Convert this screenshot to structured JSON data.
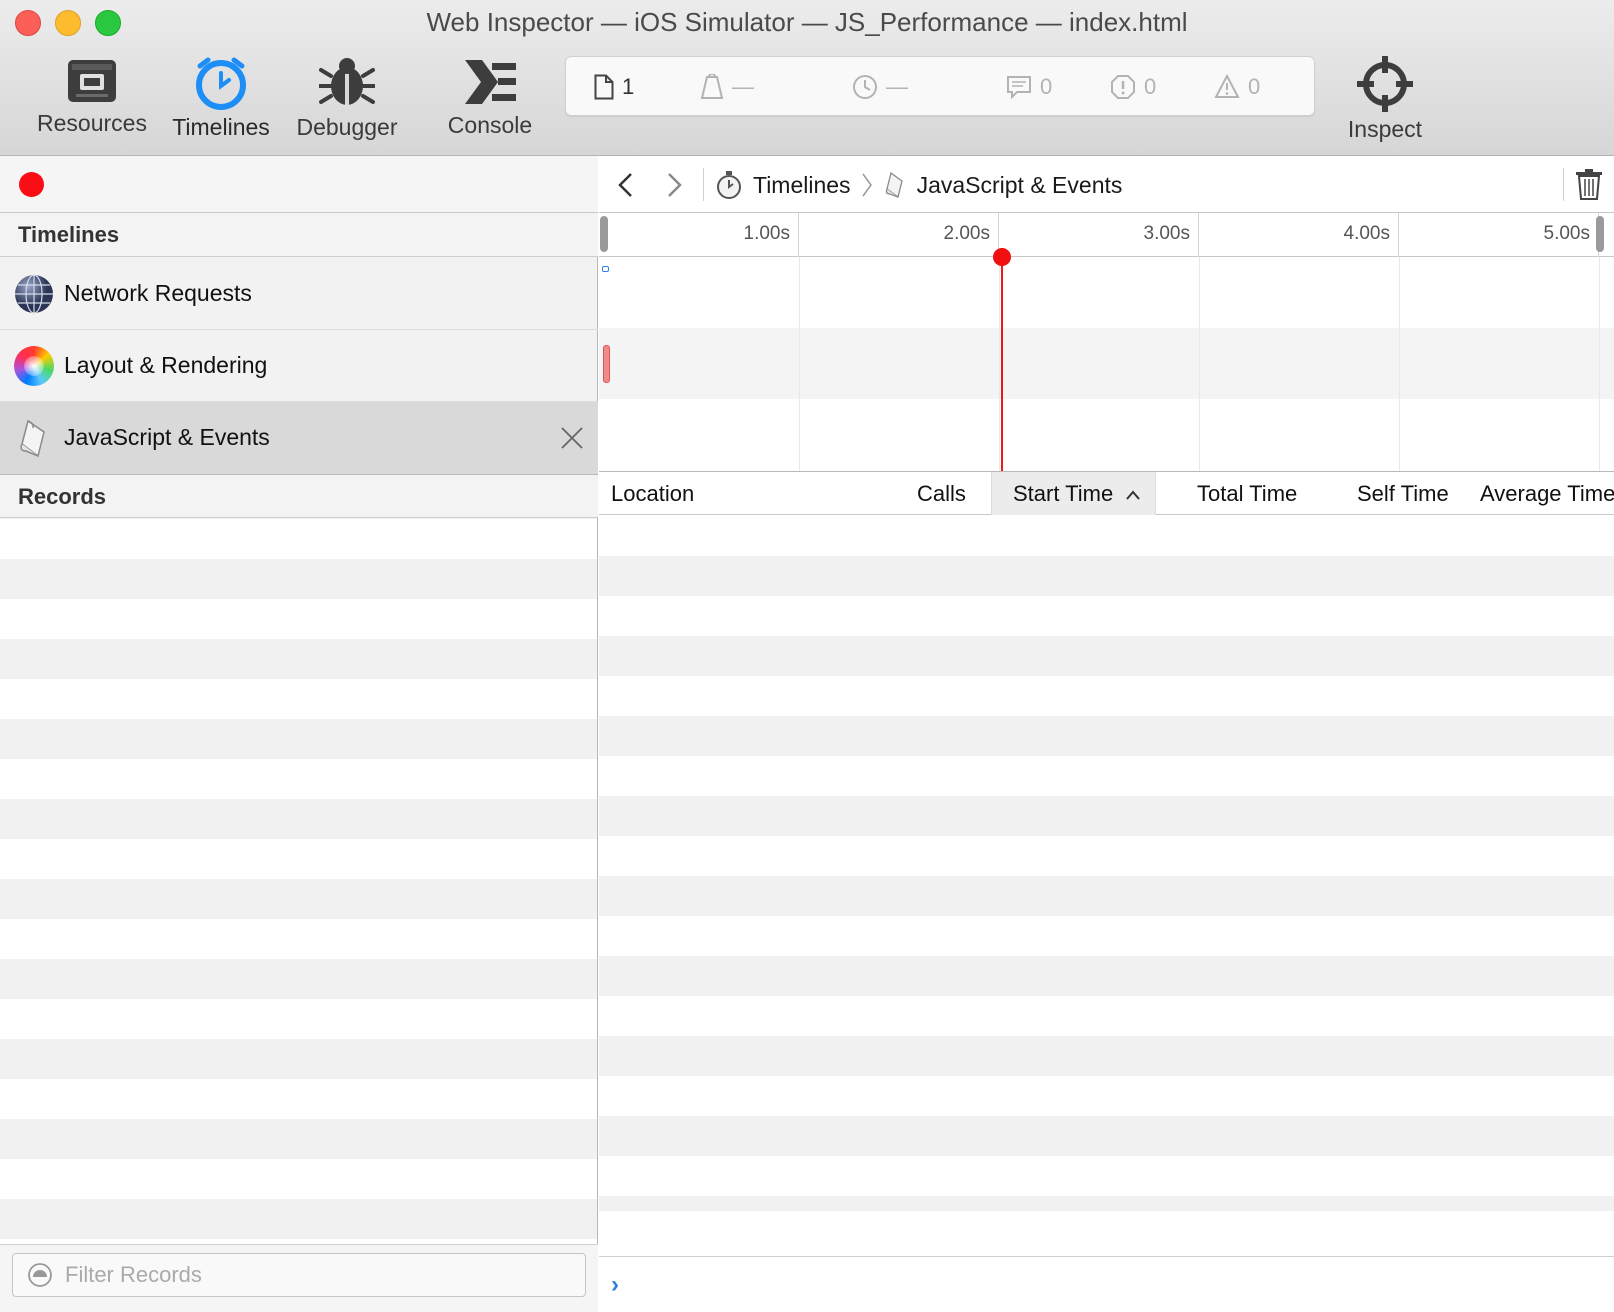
{
  "window": {
    "title": "Web Inspector — iOS Simulator — JS_Performance — index.html"
  },
  "toolbar": {
    "tabs": [
      {
        "label": "Resources",
        "icon": "resources-icon"
      },
      {
        "label": "Timelines",
        "icon": "timelines-icon",
        "active": true
      },
      {
        "label": "Debugger",
        "icon": "debugger-icon"
      },
      {
        "label": "Console",
        "icon": "console-icon"
      }
    ],
    "inspect_label": "Inspect"
  },
  "dashboard": {
    "resources_count": "1",
    "resources_size": "—",
    "load_time": "—",
    "logs": "0",
    "errors": "0",
    "issues": "0"
  },
  "sidebar": {
    "timelines_header": "Timelines",
    "timelines": [
      {
        "label": "Network Requests",
        "icon": "network-globe-icon"
      },
      {
        "label": "Layout & Rendering",
        "icon": "color-wheel-icon"
      },
      {
        "label": "JavaScript & Events",
        "icon": "script-scroll-icon",
        "selected": true
      }
    ],
    "records_header": "Records",
    "filter_placeholder": "Filter Records"
  },
  "navigation": {
    "breadcrumb": [
      "Timelines",
      "JavaScript & Events"
    ]
  },
  "ruler": {
    "ticks": [
      "1.00s",
      "2.00s",
      "3.00s",
      "4.00s",
      "5.00s"
    ]
  },
  "table": {
    "columns": [
      "Location",
      "Calls",
      "Start Time",
      "Total Time",
      "Self Time",
      "Average Time"
    ],
    "sorted_column": "Start Time",
    "sort_direction": "ascending"
  },
  "colors": {
    "record": "#fa0d14",
    "playhead": "#e91a1a",
    "active_tab": "#1e90ff",
    "prompt": "#2d7fe0"
  }
}
